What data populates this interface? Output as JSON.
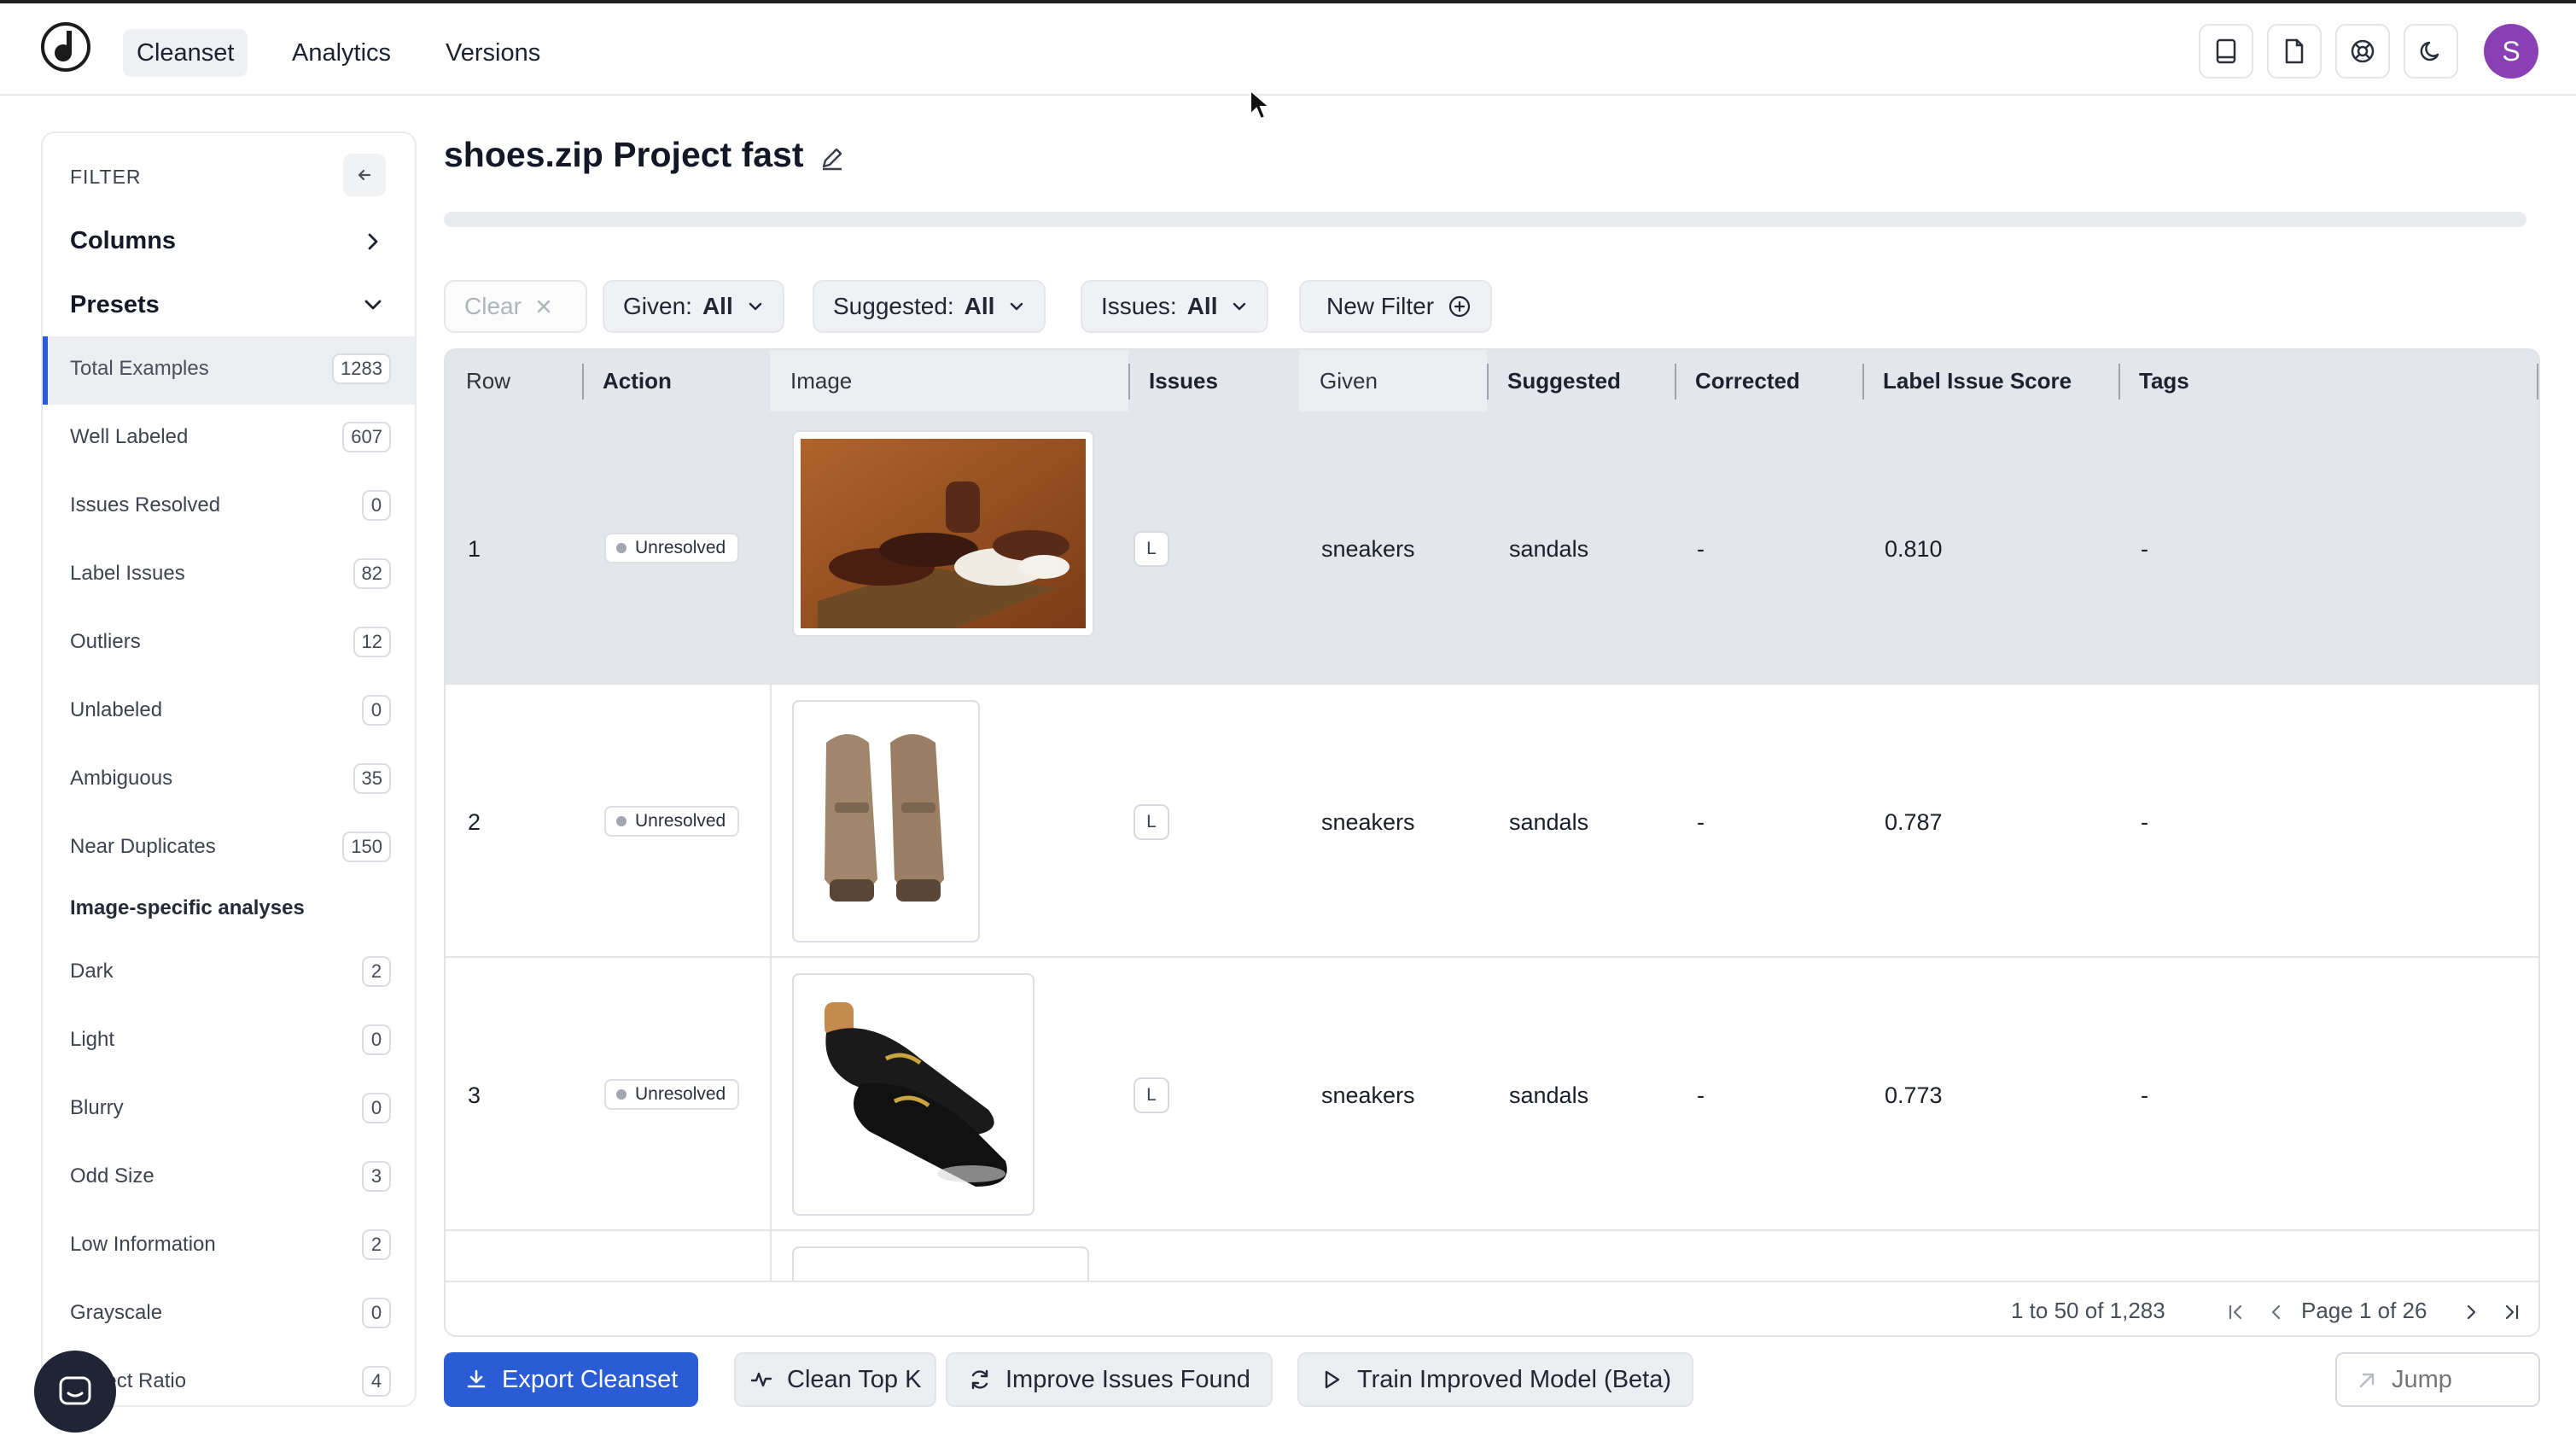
{
  "app": {
    "nav_tabs": [
      {
        "label": "Cleanset",
        "active": true
      },
      {
        "label": "Analytics",
        "active": false
      },
      {
        "label": "Versions",
        "active": false
      }
    ],
    "top_icons": [
      "book-icon",
      "document-icon",
      "help-lifebuoy-icon",
      "moon-icon"
    ],
    "avatar_initial": "S",
    "accent_color": "#2a5cd6",
    "avatar_color": "#8a3fb4"
  },
  "sidebar": {
    "filter_title": "FILTER",
    "columns_label": "Columns",
    "presets_label": "Presets",
    "presets": [
      {
        "label": "Total Examples",
        "count": "1283",
        "active": true
      },
      {
        "label": "Well Labeled",
        "count": "607"
      },
      {
        "label": "Issues Resolved",
        "count": "0"
      },
      {
        "label": "Label Issues",
        "count": "82"
      },
      {
        "label": "Outliers",
        "count": "12"
      },
      {
        "label": "Unlabeled",
        "count": "0"
      },
      {
        "label": "Ambiguous",
        "count": "35"
      },
      {
        "label": "Near Duplicates",
        "count": "150"
      }
    ],
    "image_section_label": "Image-specific analyses",
    "image_presets": [
      {
        "label": "Dark",
        "count": "2"
      },
      {
        "label": "Light",
        "count": "0"
      },
      {
        "label": "Blurry",
        "count": "0"
      },
      {
        "label": "Odd Size",
        "count": "3"
      },
      {
        "label": "Low Information",
        "count": "2"
      },
      {
        "label": "Grayscale",
        "count": "0"
      },
      {
        "label": "Aspect Ratio",
        "count": "4"
      }
    ]
  },
  "main": {
    "project_title": "shoes.zip Project fast",
    "filters": {
      "clear_label": "Clear",
      "given_label": "Given:",
      "given_value": "All",
      "suggested_label": "Suggested:",
      "suggested_value": "All",
      "issues_label": "Issues:",
      "issues_value": "All",
      "new_filter_label": "New Filter"
    },
    "table": {
      "columns": [
        "Row",
        "Action",
        "Image",
        "Issues",
        "Given",
        "Suggested",
        "Corrected",
        "Label Issue Score",
        "Tags"
      ],
      "rows": [
        {
          "row": "1",
          "action": "Unresolved",
          "issue": "L",
          "given": "sneakers",
          "suggested": "sandals",
          "corrected": "-",
          "score": "0.810",
          "tags": "-",
          "image": "brown-loafers-on-wood"
        },
        {
          "row": "2",
          "action": "Unresolved",
          "issue": "L",
          "given": "sneakers",
          "suggested": "sandals",
          "corrected": "-",
          "score": "0.787",
          "tags": "-",
          "image": "tan-loafers-pair"
        },
        {
          "row": "3",
          "action": "Unresolved",
          "issue": "L",
          "given": "sneakers",
          "suggested": "sandals",
          "corrected": "-",
          "score": "0.773",
          "tags": "-",
          "image": "black-horsebit-loafers"
        }
      ]
    },
    "pager": {
      "range_text": "1 to 50 of 1,283",
      "page_text": "Page 1 of 26"
    },
    "actions": {
      "export_label": "Export Cleanset",
      "clean_top_k_label": "Clean Top K",
      "improve_label": "Improve Issues Found",
      "train_label": "Train Improved Model (Beta)",
      "jump_placeholder": "Jump"
    }
  }
}
